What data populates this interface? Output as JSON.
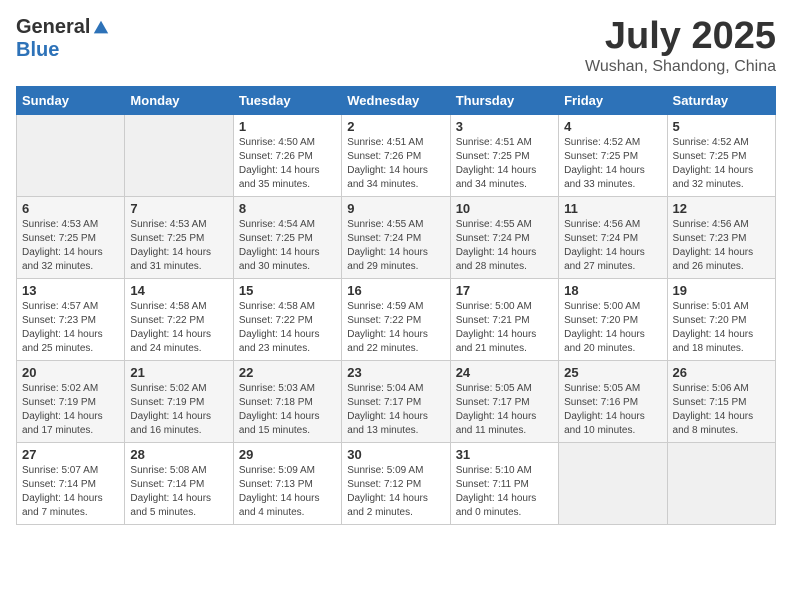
{
  "logo": {
    "general": "General",
    "blue": "Blue"
  },
  "title": "July 2025",
  "location": "Wushan, Shandong, China",
  "weekdays": [
    "Sunday",
    "Monday",
    "Tuesday",
    "Wednesday",
    "Thursday",
    "Friday",
    "Saturday"
  ],
  "weeks": [
    [
      {
        "day": "",
        "detail": ""
      },
      {
        "day": "",
        "detail": ""
      },
      {
        "day": "1",
        "detail": "Sunrise: 4:50 AM\nSunset: 7:26 PM\nDaylight: 14 hours\nand 35 minutes."
      },
      {
        "day": "2",
        "detail": "Sunrise: 4:51 AM\nSunset: 7:26 PM\nDaylight: 14 hours\nand 34 minutes."
      },
      {
        "day": "3",
        "detail": "Sunrise: 4:51 AM\nSunset: 7:25 PM\nDaylight: 14 hours\nand 34 minutes."
      },
      {
        "day": "4",
        "detail": "Sunrise: 4:52 AM\nSunset: 7:25 PM\nDaylight: 14 hours\nand 33 minutes."
      },
      {
        "day": "5",
        "detail": "Sunrise: 4:52 AM\nSunset: 7:25 PM\nDaylight: 14 hours\nand 32 minutes."
      }
    ],
    [
      {
        "day": "6",
        "detail": "Sunrise: 4:53 AM\nSunset: 7:25 PM\nDaylight: 14 hours\nand 32 minutes."
      },
      {
        "day": "7",
        "detail": "Sunrise: 4:53 AM\nSunset: 7:25 PM\nDaylight: 14 hours\nand 31 minutes."
      },
      {
        "day": "8",
        "detail": "Sunrise: 4:54 AM\nSunset: 7:25 PM\nDaylight: 14 hours\nand 30 minutes."
      },
      {
        "day": "9",
        "detail": "Sunrise: 4:55 AM\nSunset: 7:24 PM\nDaylight: 14 hours\nand 29 minutes."
      },
      {
        "day": "10",
        "detail": "Sunrise: 4:55 AM\nSunset: 7:24 PM\nDaylight: 14 hours\nand 28 minutes."
      },
      {
        "day": "11",
        "detail": "Sunrise: 4:56 AM\nSunset: 7:24 PM\nDaylight: 14 hours\nand 27 minutes."
      },
      {
        "day": "12",
        "detail": "Sunrise: 4:56 AM\nSunset: 7:23 PM\nDaylight: 14 hours\nand 26 minutes."
      }
    ],
    [
      {
        "day": "13",
        "detail": "Sunrise: 4:57 AM\nSunset: 7:23 PM\nDaylight: 14 hours\nand 25 minutes."
      },
      {
        "day": "14",
        "detail": "Sunrise: 4:58 AM\nSunset: 7:22 PM\nDaylight: 14 hours\nand 24 minutes."
      },
      {
        "day": "15",
        "detail": "Sunrise: 4:58 AM\nSunset: 7:22 PM\nDaylight: 14 hours\nand 23 minutes."
      },
      {
        "day": "16",
        "detail": "Sunrise: 4:59 AM\nSunset: 7:22 PM\nDaylight: 14 hours\nand 22 minutes."
      },
      {
        "day": "17",
        "detail": "Sunrise: 5:00 AM\nSunset: 7:21 PM\nDaylight: 14 hours\nand 21 minutes."
      },
      {
        "day": "18",
        "detail": "Sunrise: 5:00 AM\nSunset: 7:20 PM\nDaylight: 14 hours\nand 20 minutes."
      },
      {
        "day": "19",
        "detail": "Sunrise: 5:01 AM\nSunset: 7:20 PM\nDaylight: 14 hours\nand 18 minutes."
      }
    ],
    [
      {
        "day": "20",
        "detail": "Sunrise: 5:02 AM\nSunset: 7:19 PM\nDaylight: 14 hours\nand 17 minutes."
      },
      {
        "day": "21",
        "detail": "Sunrise: 5:02 AM\nSunset: 7:19 PM\nDaylight: 14 hours\nand 16 minutes."
      },
      {
        "day": "22",
        "detail": "Sunrise: 5:03 AM\nSunset: 7:18 PM\nDaylight: 14 hours\nand 15 minutes."
      },
      {
        "day": "23",
        "detail": "Sunrise: 5:04 AM\nSunset: 7:17 PM\nDaylight: 14 hours\nand 13 minutes."
      },
      {
        "day": "24",
        "detail": "Sunrise: 5:05 AM\nSunset: 7:17 PM\nDaylight: 14 hours\nand 11 minutes."
      },
      {
        "day": "25",
        "detail": "Sunrise: 5:05 AM\nSunset: 7:16 PM\nDaylight: 14 hours\nand 10 minutes."
      },
      {
        "day": "26",
        "detail": "Sunrise: 5:06 AM\nSunset: 7:15 PM\nDaylight: 14 hours\nand 8 minutes."
      }
    ],
    [
      {
        "day": "27",
        "detail": "Sunrise: 5:07 AM\nSunset: 7:14 PM\nDaylight: 14 hours\nand 7 minutes."
      },
      {
        "day": "28",
        "detail": "Sunrise: 5:08 AM\nSunset: 7:14 PM\nDaylight: 14 hours\nand 5 minutes."
      },
      {
        "day": "29",
        "detail": "Sunrise: 5:09 AM\nSunset: 7:13 PM\nDaylight: 14 hours\nand 4 minutes."
      },
      {
        "day": "30",
        "detail": "Sunrise: 5:09 AM\nSunset: 7:12 PM\nDaylight: 14 hours\nand 2 minutes."
      },
      {
        "day": "31",
        "detail": "Sunrise: 5:10 AM\nSunset: 7:11 PM\nDaylight: 14 hours\nand 0 minutes."
      },
      {
        "day": "",
        "detail": ""
      },
      {
        "day": "",
        "detail": ""
      }
    ]
  ]
}
